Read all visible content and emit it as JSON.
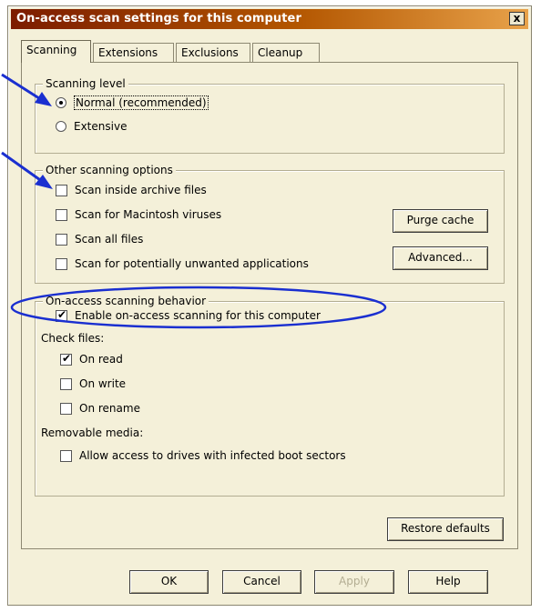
{
  "window": {
    "title": "On-access scan settings for this computer",
    "close_label": "x"
  },
  "tabs": [
    {
      "label": "Scanning",
      "active": true
    },
    {
      "label": "Extensions",
      "active": false
    },
    {
      "label": "Exclusions",
      "active": false
    },
    {
      "label": "Cleanup",
      "active": false
    }
  ],
  "scanning_level": {
    "legend": "Scanning level",
    "options": [
      {
        "label": "Normal (recommended)",
        "selected": true
      },
      {
        "label": "Extensive",
        "selected": false
      }
    ]
  },
  "other_options": {
    "legend": "Other scanning options",
    "checks": [
      {
        "label": "Scan inside archive files",
        "checked": false
      },
      {
        "label": "Scan for Macintosh viruses",
        "checked": false
      },
      {
        "label": "Scan all files",
        "checked": false
      },
      {
        "label": "Scan for potentially unwanted applications",
        "checked": false
      }
    ],
    "purge_label": "Purge cache",
    "advanced_label": "Advanced..."
  },
  "behavior": {
    "legend": "On-access scanning behavior",
    "enable_label": "Enable on-access scanning for this computer",
    "enable_checked": true,
    "check_files_label": "Check files:",
    "check_files": [
      {
        "label": "On read",
        "checked": true
      },
      {
        "label": "On write",
        "checked": false
      },
      {
        "label": "On rename",
        "checked": false
      }
    ],
    "removable_label": "Removable media:",
    "removable_check": {
      "label": "Allow access to drives with infected boot sectors",
      "checked": false
    }
  },
  "restore_label": "Restore defaults",
  "footer": {
    "ok_label": "OK",
    "cancel_label": "Cancel",
    "apply_label": "Apply",
    "help_label": "Help"
  },
  "colors": {
    "annotation": "#1a2fd0",
    "titlebar_start": "#7c1c00",
    "dialog_bg": "#f4f0d9"
  }
}
